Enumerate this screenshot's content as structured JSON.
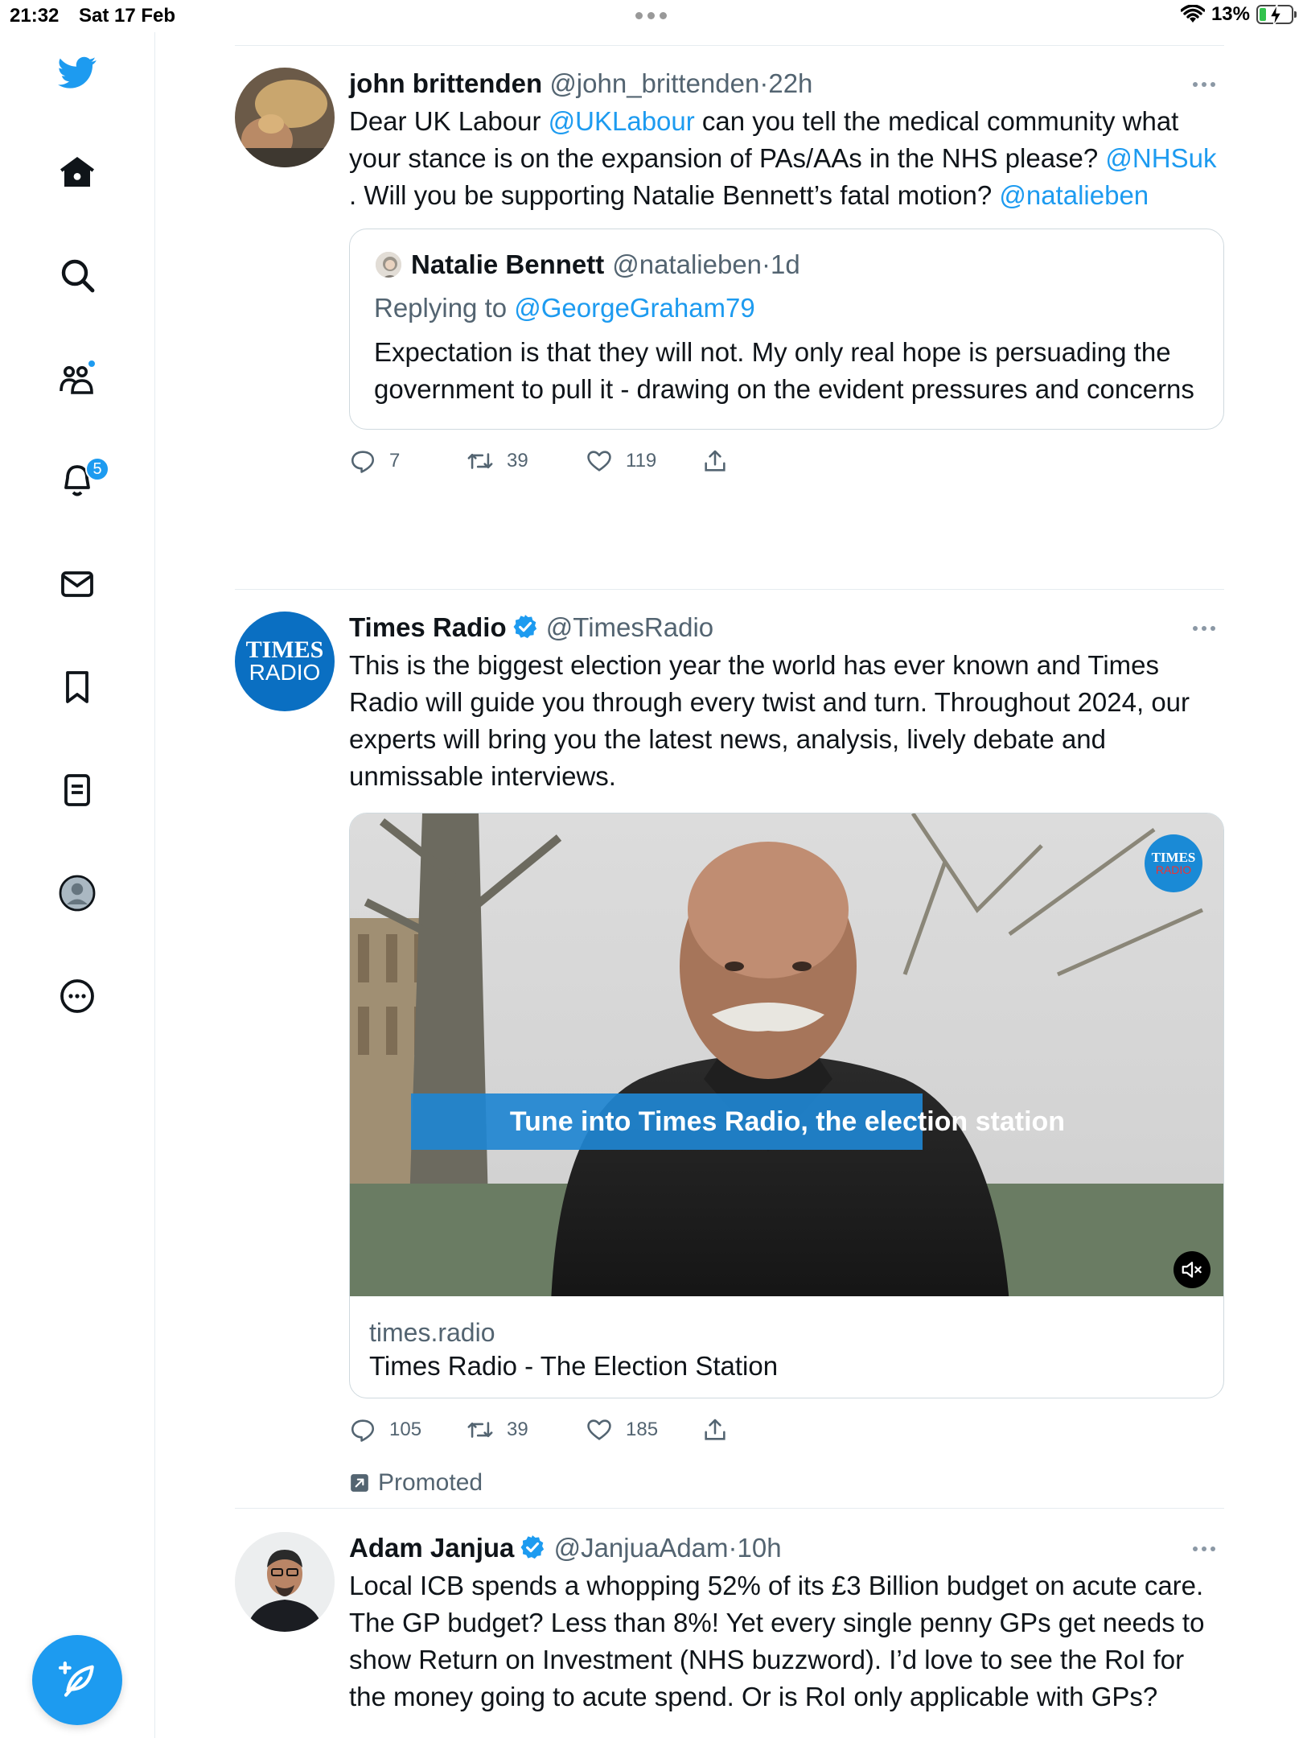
{
  "status_bar": {
    "time": "21:32",
    "date": "Sat 17 Feb",
    "battery": "13%"
  },
  "sidebar": {
    "notifications_badge": "5"
  },
  "tweets": [
    {
      "name": "john brittenden",
      "handle": "@john_brittenden",
      "sep": "·",
      "time": "22h",
      "text_parts": {
        "p1": "Dear UK Labour ",
        "m1": "@UKLabour",
        "p2": " can you tell the medical community what your stance is on the expansion of PAs/AAs in the NHS please? ",
        "m2": "@NHSuk",
        "p3": " . Will you be supporting Natalie Bennett’s fatal motion? ",
        "m3": "@natalieben"
      },
      "quote": {
        "name": "Natalie Bennett",
        "handle": "@natalieben",
        "sep": "·",
        "time": "1d",
        "replying_label": "Replying to ",
        "replying_to": "@GeorgeGraham79",
        "text": "Expectation is that they will not. My only real hope is persuading the government to pull it - drawing on the evident pressures and concerns"
      },
      "replies": "7",
      "retweets": "39",
      "likes": "119"
    },
    {
      "name": "Times Radio",
      "handle": "@TimesRadio",
      "text": "This is the biggest election year the world has ever known and Times Radio will guide you through every twist and turn. Throughout 2024, our experts will bring you the latest news, analysis, lively debate and unmissable interviews.",
      "avatar_text_1": "TIMES",
      "avatar_text_2": "RADIO",
      "video_caption": "Tune into Times Radio, the election station",
      "video_logo_1": "TIMES",
      "video_logo_2": "RADIO",
      "card_domain": "times.radio",
      "card_title": "Times Radio - The Election Station",
      "replies": "105",
      "retweets": "39",
      "likes": "185",
      "promoted_label": "Promoted"
    },
    {
      "name": "Adam Janjua",
      "handle": "@JanjuaAdam",
      "sep": "·",
      "time": "10h",
      "text": "Local ICB spends a whopping 52% of its £3 Billion budget on acute care. The GP budget? Less than 8%! Yet every single penny GPs get needs to show Return on Investment (NHS buzzword). I’d love to see the RoI for the money going to acute spend. Or is RoI only applicable with GPs?"
    }
  ],
  "colors": {
    "accent": "#1d9bf0",
    "text": "#0f1419",
    "secondary": "#536471",
    "border": "#cfd9de"
  },
  "icons": [
    "twitter-bird-icon",
    "home-icon",
    "search-icon",
    "communities-icon",
    "notifications-bell-icon",
    "messages-icon",
    "bookmark-icon",
    "lists-icon",
    "profile-icon",
    "more-icon",
    "compose-icon",
    "reply-icon",
    "retweet-icon",
    "like-icon",
    "share-icon",
    "verified-icon",
    "mute-icon",
    "promoted-icon",
    "wifi-icon",
    "battery-icon"
  ]
}
